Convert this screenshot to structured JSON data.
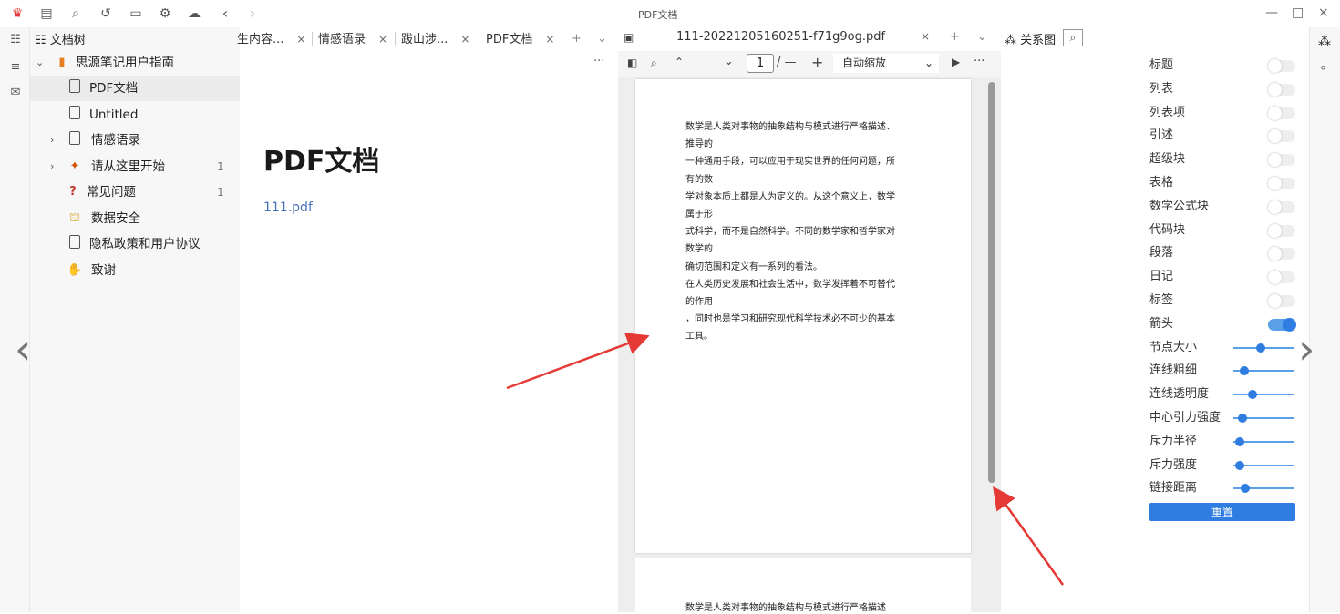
{
  "window": {
    "title": "PDF文档",
    "minimize": "—",
    "maximize": "□",
    "close": "×"
  },
  "tree": {
    "header": "文档树",
    "items": [
      {
        "label": "思源笔记用户指南",
        "count": ""
      },
      {
        "label": "PDF文档",
        "count": ""
      },
      {
        "label": "Untitled",
        "count": ""
      },
      {
        "label": "情感语录",
        "count": ""
      },
      {
        "label": "请从这里开始",
        "count": "1"
      },
      {
        "label": "常见问题",
        "count": "1"
      },
      {
        "label": "数据安全",
        "count": ""
      },
      {
        "label": "隐私政策和用户协议",
        "count": ""
      },
      {
        "label": "致谢",
        "count": ""
      }
    ]
  },
  "tabs": [
    {
      "label": "生内容..."
    },
    {
      "label": "情感语录"
    },
    {
      "label": "跋山涉..."
    },
    {
      "label": "PDF文档"
    }
  ],
  "tab_close": "×",
  "tab_add": "+",
  "tab_more": "⌄",
  "editor": {
    "title": "PDF文档",
    "link": "111.pdf"
  },
  "pdf": {
    "tab_label": "111-20221205160251-f71g9og.pdf",
    "page_input": "1",
    "page_total": "/ —",
    "zoom": "自动缩放",
    "lines": [
      "数学是人类对事物的抽象结构与模式进行严格描述、",
      "推导的",
      "一种通用手段，可以应用于现实世界的任何问题，所",
      "有的数",
      "学对象本质上都是人为定义的。从这个意义上，数学",
      "属于形",
      "式科学，而不是自然科学。不同的数学家和哲学家对",
      "数学的",
      "确切范围和定义有一系列的看法。",
      "在人类历史发展和社会生活中，数学发挥着不可替代",
      "的作用",
      "，同时也是学习和研究现代科学技术必不可少的基本",
      "工具。"
    ],
    "page2_line": "数学是人类对事物的抽象结构与模式进行严格描述"
  },
  "graph": {
    "title": "关系图",
    "settings": [
      {
        "label": "标题",
        "kind": "toggle",
        "on": false
      },
      {
        "label": "列表",
        "kind": "toggle",
        "on": false
      },
      {
        "label": "列表项",
        "kind": "toggle",
        "on": false
      },
      {
        "label": "引述",
        "kind": "toggle",
        "on": false
      },
      {
        "label": "超级块",
        "kind": "toggle",
        "on": false
      },
      {
        "label": "表格",
        "kind": "toggle",
        "on": false
      },
      {
        "label": "数学公式块",
        "kind": "toggle",
        "on": false
      },
      {
        "label": "代码块",
        "kind": "toggle",
        "on": false
      },
      {
        "label": "段落",
        "kind": "toggle",
        "on": false
      },
      {
        "label": "日记",
        "kind": "toggle",
        "on": false
      },
      {
        "label": "标签",
        "kind": "toggle",
        "on": false
      },
      {
        "label": "箭头",
        "kind": "toggle",
        "on": true
      },
      {
        "label": "节点大小",
        "kind": "slider",
        "value": 0.45
      },
      {
        "label": "连线粗细",
        "kind": "slider",
        "value": 0.18
      },
      {
        "label": "连线透明度",
        "kind": "slider",
        "value": 0.32
      },
      {
        "label": "中心引力强度",
        "kind": "slider",
        "value": 0.15
      },
      {
        "label": "斥力半径",
        "kind": "slider",
        "value": 0.1
      },
      {
        "label": "斥力强度",
        "kind": "slider",
        "value": 0.1
      },
      {
        "label": "链接距离",
        "kind": "slider",
        "value": 0.2
      }
    ],
    "reset": "重置"
  },
  "colors": {
    "accent": "#2f7de1",
    "annotation_arrow": "#e53935"
  }
}
